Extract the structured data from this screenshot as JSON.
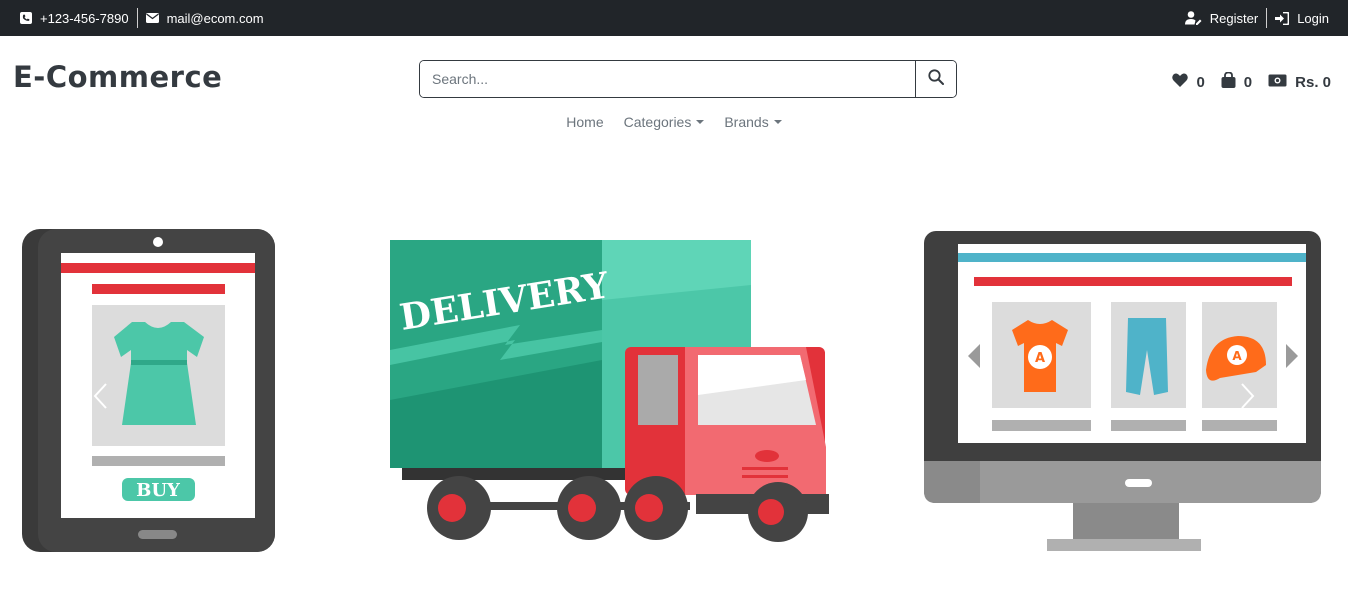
{
  "topbar": {
    "phone": "+123-456-7890",
    "email": "mail@ecom.com",
    "register": "Register",
    "login": "Login"
  },
  "header": {
    "logo": "E-Commerce",
    "search_placeholder": "Search..."
  },
  "stats": {
    "wishlist_count": "0",
    "cart_count": "0",
    "total": "Rs. 0"
  },
  "nav": {
    "home": "Home",
    "categories": "Categories",
    "brands": "Brands"
  },
  "banner": {
    "delivery_text": "DELIVERY",
    "buy_text": "BUY",
    "logo_letter": "A"
  },
  "colors": {
    "topbar_bg": "#212529",
    "text_dark": "#343a40",
    "teal": "#4cc7a8",
    "red": "#e2323a",
    "orange": "#ff6b1a",
    "blue": "#4fb3c9"
  }
}
